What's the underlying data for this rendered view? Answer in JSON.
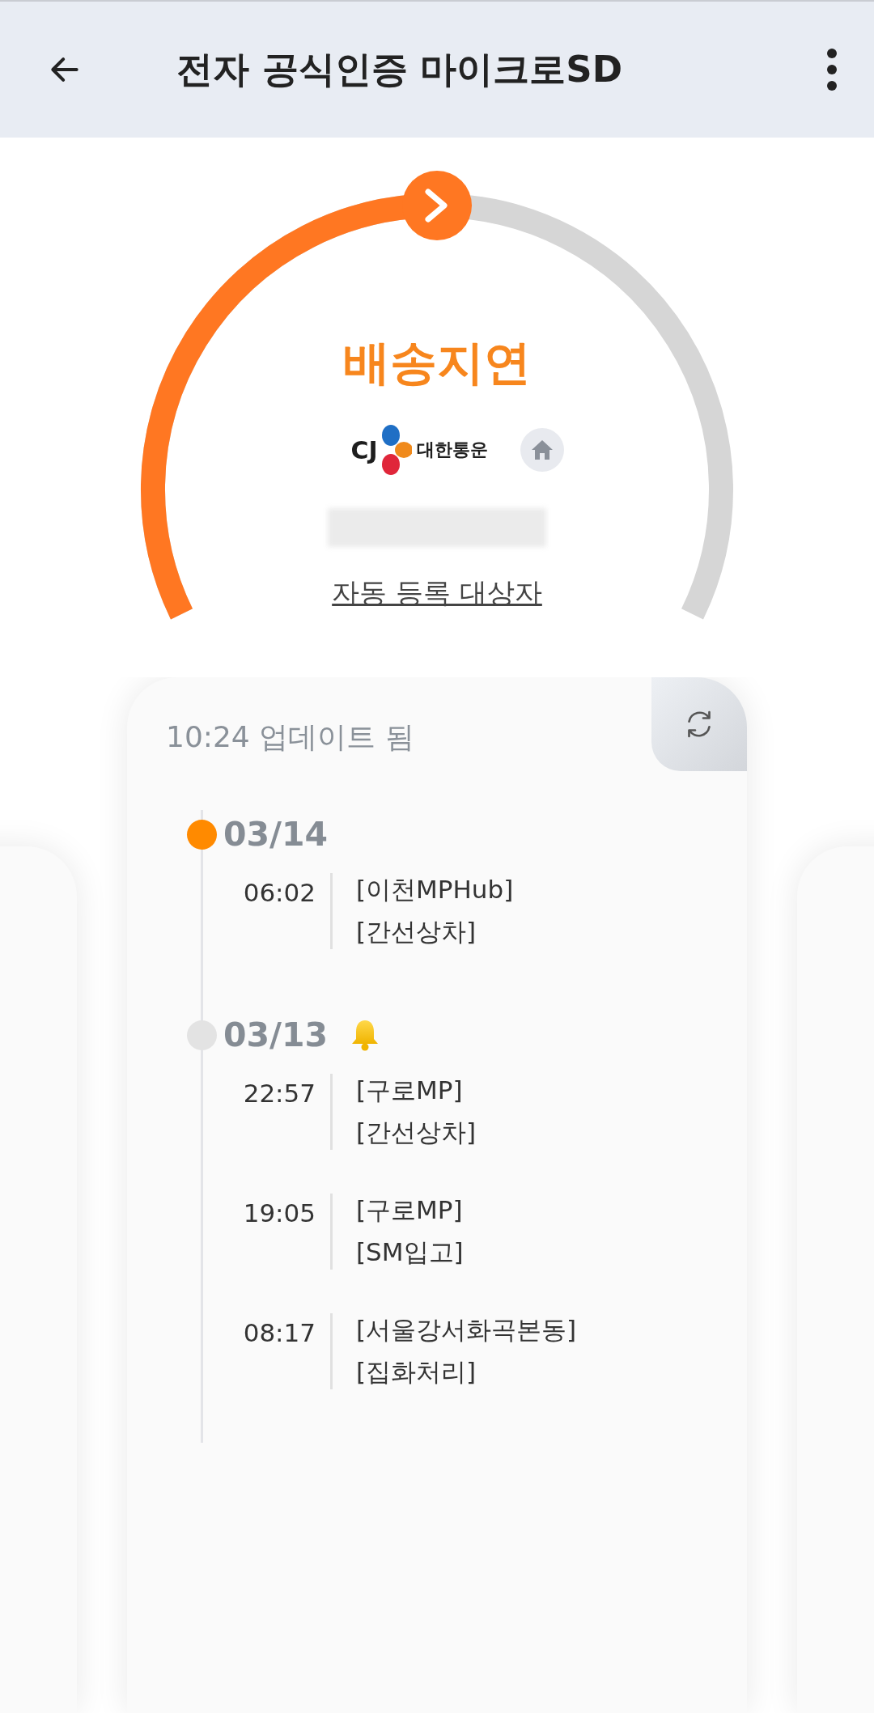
{
  "header": {
    "title": "전자 공식인증 마이크로SD"
  },
  "gauge": {
    "status": "배송지연",
    "level": 0.5
  },
  "carrier": {
    "logo_text": "CJ",
    "name": "대한통운"
  },
  "auto_register_link": "자동 등록 대상자",
  "tracking": {
    "updated": "10:24 업데이트 됨",
    "days": [
      {
        "date": "03/14",
        "current": true,
        "alert": false,
        "events": [
          {
            "time": "06:02",
            "lines": [
              "[이천MPHub]",
              "[간선상차]"
            ]
          }
        ]
      },
      {
        "date": "03/13",
        "current": false,
        "alert": true,
        "events": [
          {
            "time": "22:57",
            "lines": [
              "[구로MP]",
              "[간선상차]"
            ]
          },
          {
            "time": "19:05",
            "lines": [
              "[구로MP]",
              "[SM입고]"
            ]
          },
          {
            "time": "08:17",
            "lines": [
              "[서울강서화곡본동]",
              "[집화처리]"
            ]
          }
        ]
      }
    ]
  }
}
